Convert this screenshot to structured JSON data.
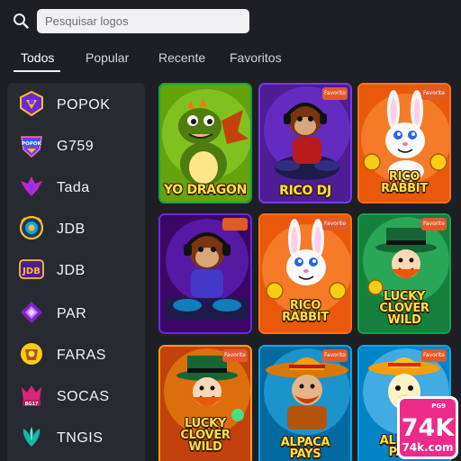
{
  "search": {
    "placeholder": "Pesquisar logos",
    "value": ""
  },
  "tabs": [
    {
      "label": "Todos",
      "active": true
    },
    {
      "label": "Popular",
      "active": false
    },
    {
      "label": "Recente",
      "active": false
    },
    {
      "label": "Favoritos",
      "active": false
    }
  ],
  "sidebar": {
    "items": [
      {
        "label": "POPOK",
        "icon": "popok-logo"
      },
      {
        "label": "G759",
        "icon": "g759-logo"
      },
      {
        "label": "Tada",
        "icon": "tada-logo"
      },
      {
        "label": "JDB",
        "icon": "jdb-badge-logo"
      },
      {
        "label": "JDB",
        "icon": "jdb-text-logo"
      },
      {
        "label": "PAR",
        "icon": "par-logo"
      },
      {
        "label": "FARAS",
        "icon": "faras-logo"
      },
      {
        "label": "SOCAS",
        "icon": "socas-logo"
      },
      {
        "label": "TNGIS",
        "icon": "tngis-logo"
      }
    ]
  },
  "games": [
    {
      "title": "YO DRAGON",
      "favorite": false,
      "character": "dragon"
    },
    {
      "title": "RICO DJ",
      "favorite": true,
      "favorite_label": "Favorito",
      "character": "dj-monkey"
    },
    {
      "title": "RICO RABBIT",
      "favorite": true,
      "favorite_label": "Favorite",
      "character": "rabbit"
    },
    {
      "title": "",
      "favorite": true,
      "favorite_label": "",
      "character": "dj-monkey"
    },
    {
      "title": "RICO RABBIT",
      "favorite": true,
      "favorite_label": "Favorite",
      "character": "rabbit"
    },
    {
      "title": "LUCKY CLOVER WILD",
      "favorite": true,
      "favorite_label": "Favorite",
      "character": "leprechaun"
    },
    {
      "title": "LUCKY CLOVER WILD",
      "favorite": true,
      "favorite_label": "Favorite",
      "character": "leprechaun"
    },
    {
      "title": "ALPACA PAYS",
      "favorite": true,
      "favorite_label": "Favorito",
      "character": "mariachi"
    },
    {
      "title": "ALPACA PAYS",
      "favorite": true,
      "favorite_label": "Favorite",
      "character": "alpaca"
    }
  ],
  "watermark": {
    "top": "PG9",
    "big": "74K",
    "domain": "74k.com"
  },
  "colors": {
    "background": "#1d1f24",
    "sidebar": "#272a31",
    "title_yellow": "#fde047",
    "favorite_badge": "#e15a2a",
    "brand_pink": "#ec2a8a"
  }
}
